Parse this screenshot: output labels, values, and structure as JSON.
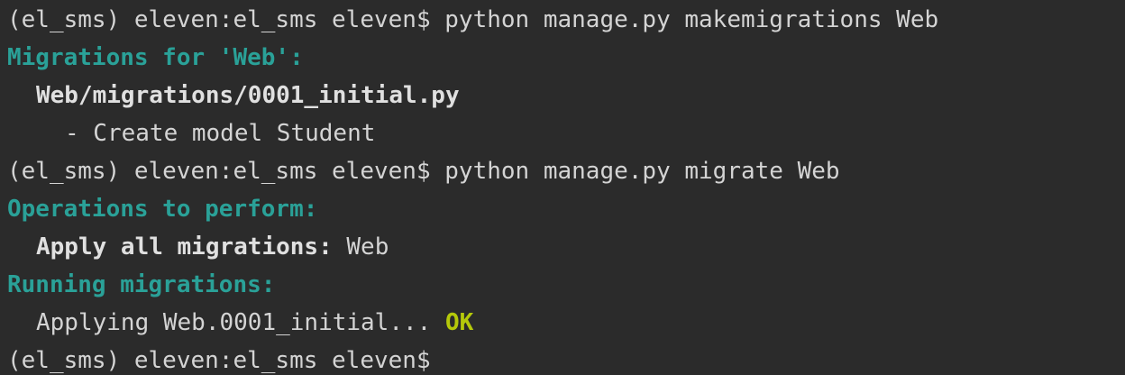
{
  "prompt": "(el_sms) eleven:el_sms eleven$",
  "lines": {
    "cmd1": "python manage.py makemigrations Web",
    "migrations_for": "Migrations for 'Web':",
    "migration_file": "Web/migrations/0001_initial.py",
    "create_model": "- Create model Student",
    "cmd2": "python manage.py migrate Web",
    "operations_header": "Operations to perform:",
    "apply_all_label": "Apply all migrations:",
    "apply_all_value": "Web",
    "running_header": "Running migrations:",
    "applying_text": "Applying Web.0001_initial...",
    "ok_status": "OK"
  },
  "colors": {
    "background": "#2b2b2b",
    "text": "#d4d4d4",
    "header_cyan": "#2aa198",
    "ok_green": "#b5c90a"
  }
}
